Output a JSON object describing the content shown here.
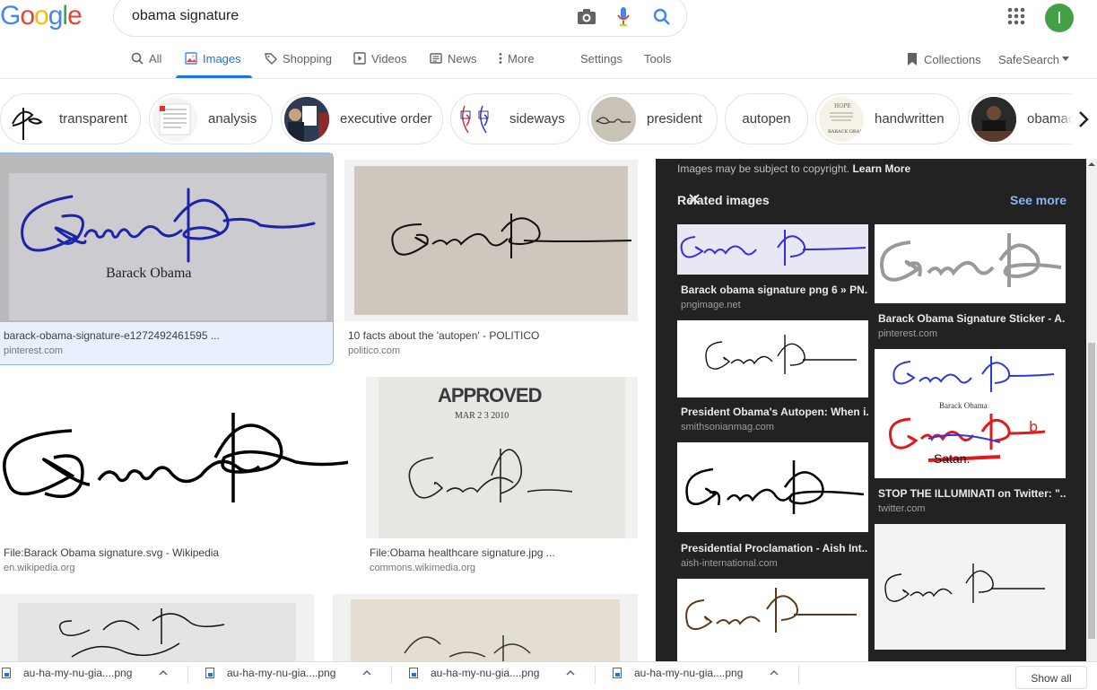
{
  "header": {
    "logo": [
      "G",
      "o",
      "o",
      "g",
      "l",
      "e"
    ],
    "logo_colors": [
      "#4285f4",
      "#ea4335",
      "#fbbc05",
      "#4285f4",
      "#34a853",
      "#ea4335"
    ],
    "query": "obama signature",
    "avatar_letter": "I"
  },
  "tabs": [
    {
      "label": "All"
    },
    {
      "label": "Images"
    },
    {
      "label": "Shopping"
    },
    {
      "label": "Videos"
    },
    {
      "label": "News"
    },
    {
      "label": "More"
    },
    {
      "label": "Settings"
    },
    {
      "label": "Tools"
    }
  ],
  "collections_label": "Collections",
  "safesearch_label": "SafeSearch",
  "chips": [
    "transparent",
    "analysis",
    "executive order",
    "sideways",
    "president",
    "autopen",
    "handwritten",
    "obamac"
  ],
  "results": [
    {
      "title": "barack-obama-signature-e1272492461595 ...",
      "source": "pinterest.com",
      "caption": "Barack Obama"
    },
    {
      "title": "10 facts about the 'autopen' - POLITICO",
      "source": "politico.com"
    },
    {
      "title": "File:Barack Obama signature.svg - Wikipedia",
      "source": "en.wikipedia.org"
    },
    {
      "title": "File:Obama healthcare signature.jpg ...",
      "source": "commons.wikimedia.org",
      "stamp": "APPROVED",
      "stamp_date": "MAR 2 3 2010"
    }
  ],
  "panel": {
    "notice": "Images may be subject to copyright.",
    "notice_link": "Learn More",
    "related": "Related images",
    "see_more": "See more",
    "items": [
      {
        "title": "Barack obama signature png 6 » PN...",
        "source": "pngimage.net"
      },
      {
        "title": "Barack Obama Signature Sticker - A...",
        "source": "pinterest.com"
      },
      {
        "title": "President Obama's Autopen: When i...",
        "source": "smithsonianmag.com"
      },
      {
        "title": "STOP THE ILLUMINATI on Twitter: \"...",
        "source": "twitter.com",
        "caption": "Barack Obama",
        "word": "Satan."
      },
      {
        "title": "Presidential Proclamation - Aish Int...",
        "source": "aish-international.com"
      }
    ]
  },
  "downloads": [
    "au-ha-my-nu-gia....png",
    "au-ha-my-nu-gia....png",
    "au-ha-my-nu-gia....png",
    "au-ha-my-nu-gia....png"
  ],
  "show_all": "Show all"
}
